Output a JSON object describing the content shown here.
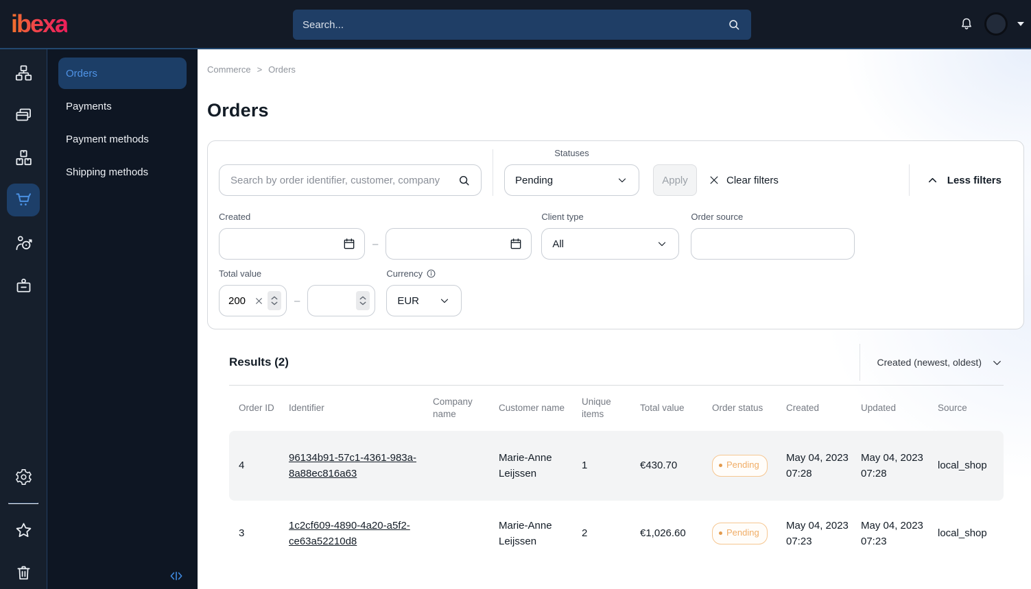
{
  "topbar": {
    "logo_text": "ibexa",
    "search_placeholder": "Search...",
    "icons": [
      "bell-icon",
      "avatar",
      "caret-down-icon",
      "search-icon"
    ]
  },
  "sidebar": {
    "rail_icons": [
      "sitemap-icon",
      "payments-card-icon",
      "product-boxes-icon",
      "cart-icon",
      "marketing-target-icon",
      "personalization-badge-icon",
      "gear-icon",
      "star-icon",
      "trash-icon"
    ],
    "active_rail_icon": "cart-icon",
    "items": [
      {
        "label": "Orders",
        "active": true
      },
      {
        "label": "Payments",
        "active": false
      },
      {
        "label": "Payment methods",
        "active": false
      },
      {
        "label": "Shipping methods",
        "active": false
      }
    ],
    "collapse_icon": "collapse-panel-icon"
  },
  "breadcrumb": {
    "parent": "Commerce",
    "separator": ">",
    "current": "Orders"
  },
  "page": {
    "title": "Orders"
  },
  "filters": {
    "search_placeholder": "Search by order identifier, customer, company",
    "statuses_label": "Statuses",
    "statuses_value": "Pending",
    "apply_label": "Apply",
    "clear_label": "Clear filters",
    "toggle_label": "Less filters",
    "created_label": "Created",
    "created_from": "",
    "created_to": "",
    "range_dash": "–",
    "client_type_label": "Client type",
    "client_type_value": "All",
    "order_source_label": "Order source",
    "order_source_value": "",
    "total_value_label": "Total value",
    "total_value_min": "200",
    "total_value_max": "",
    "currency_label": "Currency",
    "currency_value": "EUR"
  },
  "results": {
    "title": "Results (2)",
    "sort_value": "Created (newest, oldest)",
    "columns": [
      "Order ID",
      "Identifier",
      "Company name",
      "Customer name",
      "Unique items",
      "Total value",
      "Order status",
      "Created",
      "Updated",
      "Source"
    ],
    "rows": [
      {
        "order_id": "4",
        "identifier": "96134b91-57c1-4361-983a-8a88ec816a63",
        "company_name": "",
        "customer_name": "Marie-Anne Leijssen",
        "unique_items": "1",
        "total_value": "€430.70",
        "order_status": "Pending",
        "created": "May 04, 2023 07:28",
        "updated": "May 04, 2023 07:28",
        "source": "local_shop"
      },
      {
        "order_id": "3",
        "identifier": "1c2cf609-4890-4a20-a5f2-ce63a52210d8",
        "company_name": "",
        "customer_name": "Marie-Anne Leijssen",
        "unique_items": "2",
        "total_value": "€1,026.60",
        "order_status": "Pending",
        "created": "May 04, 2023 07:23",
        "updated": "May 04, 2023 07:23",
        "source": "local_shop"
      }
    ]
  },
  "colors": {
    "topbar_bg": "#131a26",
    "rail_bg": "#161f2c",
    "panel_bg": "#0e1623",
    "accent_blue": "#4a90e2",
    "active_item_bg": "#1c3e67",
    "status_pending": "#f0ad66",
    "row_alt_bg": "#f3f4f5",
    "logo_gradient": [
      "#f0712c",
      "#ed1e5a"
    ]
  }
}
